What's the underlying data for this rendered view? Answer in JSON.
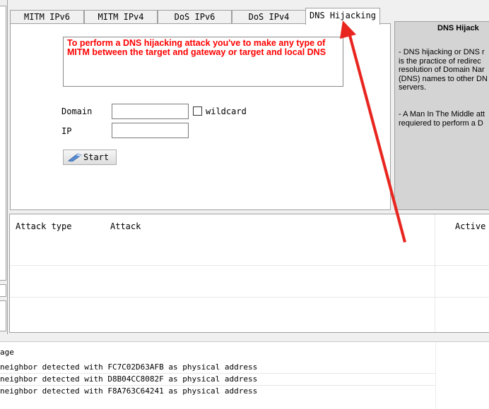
{
  "tabs": [
    {
      "label": "MITM IPv6",
      "active": false
    },
    {
      "label": "MITM IPv4",
      "active": false
    },
    {
      "label": "DoS IPv6",
      "active": false
    },
    {
      "label": "DoS IPv4",
      "active": false
    },
    {
      "label": "DNS Hijacking",
      "active": true
    }
  ],
  "dns_hijacking": {
    "warning": "To perform a DNS hijacking attack you've to make any type of MITM between the target and gateway or target and local DNS",
    "domain_label": "Domain",
    "domain_value": "",
    "wildcard_label": "wildcard",
    "wildcard_checked": false,
    "ip_label": "IP",
    "ip_value": "",
    "start_label": "Start",
    "start_icon": "wand-icon"
  },
  "info_panel": {
    "title": "DNS Hijack",
    "paragraph1": [
      "- DNS hijacking or DNS r",
      "is the practice of redirec",
      "resolution of Domain Nar",
      "(DNS) names to other DN",
      "servers."
    ],
    "paragraph2": [
      "- A Man In The Middle att",
      "requiered to perform a D"
    ]
  },
  "attacks_table": {
    "columns": [
      "Attack type",
      "Attack",
      "Active"
    ],
    "rows": []
  },
  "log": {
    "header": "age",
    "lines": [
      "neighbor detected with FC7C02D63AFB as physical address",
      "neighbor detected with D8B04CC8082F as physical address",
      "neighbor detected with F8A763C64241 as physical address"
    ]
  },
  "colors": {
    "warning_text": "#ff0000",
    "annotation_arrow": "#e8261f",
    "info_panel_bg": "#d4d4d4"
  }
}
